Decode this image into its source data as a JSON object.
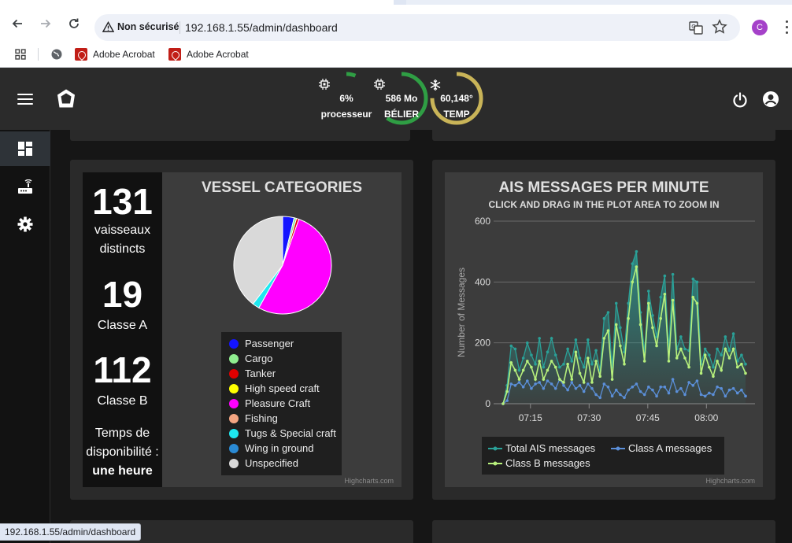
{
  "browser": {
    "security_label": "Non sécurisé",
    "url": "192.168.1.55/admin/dashboard",
    "profile_initial": "C",
    "bookmarks": [
      {
        "label": "Adobe Acrobat"
      },
      {
        "label": "Adobe Acrobat"
      }
    ],
    "status_url": "192.168.1.55/admin/dashboard"
  },
  "header": {
    "gauges": [
      {
        "name": "processeur",
        "value": "6%",
        "level": 0.06,
        "color": "#2f9e44",
        "icon": "chip-icon"
      },
      {
        "name": "BÉLIER",
        "value": "586 Mo",
        "level": 0.6,
        "color": "#2f9e44",
        "icon": "chip-icon"
      },
      {
        "name": "TEMP",
        "value": "60,148°",
        "level": 0.75,
        "color": "#c9b458",
        "icon": "snowflake-icon"
      }
    ]
  },
  "stats": {
    "vessels_count": "131",
    "vessels_label_1": "vaisseaux",
    "vessels_label_2": "distincts",
    "class_a_count": "19",
    "class_a_label": "Classe A",
    "class_b_count": "112",
    "class_b_label": "Classe B",
    "uptime_label_1": "Temps de",
    "uptime_label_2": "disponibilité :",
    "uptime_value": "une heure"
  },
  "chart_data": [
    {
      "type": "pie",
      "title": "VESSEL CATEGORIES",
      "categories": [
        "Passenger",
        "Cargo",
        "Tanker",
        "High speed craft",
        "Pleasure Craft",
        "Fishing",
        "Tugs & Special craft",
        "Wing in ground",
        "Unspecified"
      ],
      "values": [
        3.8,
        0.8,
        0.8,
        0,
        52.7,
        0,
        2.3,
        0,
        39.6
      ],
      "colors": [
        "#1414ff",
        "#90ee90",
        "#e00000",
        "#ffff00",
        "#ff00ff",
        "#f4a582",
        "#1ee8f0",
        "#2a8ad4",
        "#d9d9d9"
      ],
      "credits": "Highcharts.com"
    },
    {
      "type": "area",
      "title": "AIS MESSAGES PER MINUTE",
      "subtitle": "CLICK AND DRAG IN THE PLOT AREA TO ZOOM IN",
      "ylabel": "Number of Messages",
      "ylim": [
        0,
        600
      ],
      "yticks": [
        0,
        200,
        400,
        600
      ],
      "xticks": [
        "07:15",
        "07:30",
        "07:45",
        "08:00"
      ],
      "x_start": "07:08",
      "x_end": "08:10",
      "series": [
        {
          "name": "Total AIS messages",
          "color": "#2aa198",
          "values": [
            0,
            60,
            190,
            180,
            110,
            150,
            200,
            160,
            130,
            215,
            120,
            170,
            215,
            160,
            120,
            130,
            180,
            140,
            210,
            150,
            120,
            210,
            130,
            175,
            110,
            280,
            300,
            120,
            330,
            250,
            170,
            330,
            460,
            500,
            300,
            170,
            370,
            290,
            220,
            350,
            420,
            180,
            425,
            180,
            220,
            180,
            175,
            410,
            400,
            130,
            180,
            160,
            120,
            180,
            160,
            220,
            175,
            230,
            140,
            160,
            130
          ]
        },
        {
          "name": "Class A messages",
          "color": "#5b8fd9",
          "values": [
            0,
            10,
            65,
            60,
            70,
            55,
            75,
            50,
            65,
            70,
            50,
            75,
            65,
            50,
            80,
            60,
            45,
            70,
            50,
            60,
            40,
            65,
            50,
            30,
            20,
            65,
            55,
            25,
            45,
            30,
            20,
            45,
            55,
            65,
            40,
            30,
            55,
            45,
            25,
            55,
            55,
            35,
            80,
            40,
            50,
            30,
            70,
            60,
            75,
            30,
            25,
            35,
            30,
            55,
            50,
            25,
            45,
            50,
            35,
            45,
            25
          ]
        },
        {
          "name": "Class B messages",
          "color": "#b7f07c",
          "values": [
            0,
            40,
            135,
            110,
            80,
            110,
            140,
            120,
            80,
            140,
            80,
            110,
            140,
            120,
            80,
            70,
            130,
            80,
            170,
            100,
            70,
            150,
            70,
            140,
            90,
            215,
            240,
            80,
            260,
            190,
            130,
            280,
            400,
            450,
            260,
            140,
            330,
            250,
            190,
            280,
            360,
            140,
            340,
            150,
            180,
            150,
            120,
            350,
            330,
            100,
            160,
            120,
            90,
            140,
            110,
            180,
            150,
            180,
            120,
            130,
            100
          ]
        }
      ],
      "credits": "Highcharts.com"
    }
  ]
}
